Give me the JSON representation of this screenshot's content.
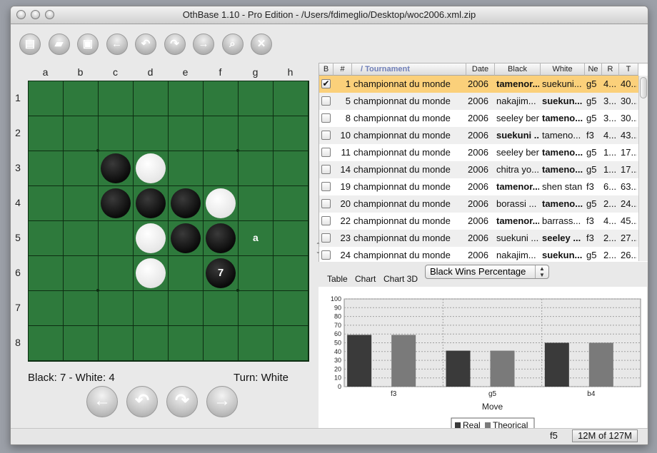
{
  "window": {
    "title": "OthBase 1.10 - Pro Edition - /Users/fdimeglio/Desktop/woc2006.xml.zip"
  },
  "toolbar": {
    "buttons": [
      {
        "name": "document-icon",
        "glyph": "▤"
      },
      {
        "name": "open-icon",
        "glyph": "▰"
      },
      {
        "name": "save-icon",
        "glyph": "▣"
      },
      {
        "name": "first-icon",
        "glyph": "←"
      },
      {
        "name": "back-icon",
        "glyph": "↶"
      },
      {
        "name": "forward-icon",
        "glyph": "↷"
      },
      {
        "name": "last-icon",
        "glyph": "→"
      },
      {
        "name": "search-icon",
        "glyph": "⌕"
      },
      {
        "name": "tools-icon",
        "glyph": "✕"
      }
    ]
  },
  "board": {
    "columns": [
      "a",
      "b",
      "c",
      "d",
      "e",
      "f",
      "g",
      "h"
    ],
    "rows": [
      "1",
      "2",
      "3",
      "4",
      "5",
      "6",
      "7",
      "8"
    ],
    "discs": [
      {
        "cell": "c3",
        "color": "black"
      },
      {
        "cell": "d3",
        "color": "white"
      },
      {
        "cell": "c4",
        "color": "black"
      },
      {
        "cell": "d4",
        "color": "black"
      },
      {
        "cell": "e4",
        "color": "black"
      },
      {
        "cell": "f4",
        "color": "white"
      },
      {
        "cell": "d5",
        "color": "white"
      },
      {
        "cell": "e5",
        "color": "black"
      },
      {
        "cell": "f5",
        "color": "black"
      },
      {
        "cell": "d6",
        "color": "white"
      },
      {
        "cell": "f6",
        "color": "black",
        "number": "7"
      }
    ],
    "hint": {
      "cell": "g5",
      "label": "a"
    },
    "colors": {
      "board": "#2e7a3c",
      "line": "#0d2d12"
    }
  },
  "status": {
    "score": "Black: 7 - White: 4",
    "turn": "Turn: White"
  },
  "nav_buttons": [
    {
      "name": "first-move-button",
      "glyph": "←"
    },
    {
      "name": "previous-move-button",
      "glyph": "↶"
    },
    {
      "name": "next-move-button",
      "glyph": "↷"
    },
    {
      "name": "last-move-button",
      "glyph": "→"
    }
  ],
  "table": {
    "columns": [
      "B",
      "#",
      "/ Tournament",
      "Date",
      "Black",
      "White",
      "Ne",
      "R",
      "T"
    ],
    "rows": [
      {
        "checked": true,
        "num": "1",
        "tournament": "championnat du monde",
        "date": "2006",
        "black": "tamenor...",
        "white": "suekuni...",
        "next": "g5",
        "r": "4...",
        "t": "40...",
        "black_bold": true,
        "white_bold": false,
        "selected": true
      },
      {
        "checked": false,
        "num": "5",
        "tournament": "championnat du monde",
        "date": "2006",
        "black": "nakajim...",
        "white": "suekun...",
        "next": "g5",
        "r": "3...",
        "t": "30...",
        "black_bold": false,
        "white_bold": true
      },
      {
        "checked": false,
        "num": "8",
        "tournament": "championnat du monde",
        "date": "2006",
        "black": "seeley ben",
        "white": "tameno...",
        "next": "g5",
        "r": "3...",
        "t": "30...",
        "black_bold": false,
        "white_bold": true
      },
      {
        "checked": false,
        "num": "10",
        "tournament": "championnat du monde",
        "date": "2006",
        "black": "suekuni ...",
        "white": "tameno...",
        "next": "f3",
        "r": "4...",
        "t": "43...",
        "black_bold": true,
        "white_bold": false
      },
      {
        "checked": false,
        "num": "11",
        "tournament": "championnat du monde",
        "date": "2006",
        "black": "seeley ben",
        "white": "tameno...",
        "next": "g5",
        "r": "1...",
        "t": "17...",
        "black_bold": false,
        "white_bold": true
      },
      {
        "checked": false,
        "num": "14",
        "tournament": "championnat du monde",
        "date": "2006",
        "black": "chitra yo...",
        "white": "tameno...",
        "next": "g5",
        "r": "1...",
        "t": "17...",
        "black_bold": false,
        "white_bold": true
      },
      {
        "checked": false,
        "num": "19",
        "tournament": "championnat du monde",
        "date": "2006",
        "black": "tamenor...",
        "white": "shen stan",
        "next": "f3",
        "r": "6...",
        "t": "63...",
        "black_bold": true,
        "white_bold": false
      },
      {
        "checked": false,
        "num": "20",
        "tournament": "championnat du monde",
        "date": "2006",
        "black": "borassi ...",
        "white": "tameno...",
        "next": "g5",
        "r": "2...",
        "t": "24...",
        "black_bold": false,
        "white_bold": true
      },
      {
        "checked": false,
        "num": "22",
        "tournament": "championnat du monde",
        "date": "2006",
        "black": "tamenor...",
        "white": "barrass...",
        "next": "f3",
        "r": "4...",
        "t": "45...",
        "black_bold": true,
        "white_bold": false
      },
      {
        "checked": false,
        "num": "23",
        "tournament": "championnat du monde",
        "date": "2006",
        "black": "suekuni ...",
        "white": "seeley ...",
        "next": "f3",
        "r": "2...",
        "t": "27...",
        "black_bold": false,
        "white_bold": true
      },
      {
        "checked": false,
        "num": "24",
        "tournament": "championnat du monde",
        "date": "2006",
        "black": "nakajim...",
        "white": "suekun...",
        "next": "g5",
        "r": "2...",
        "t": "26...",
        "black_bold": false,
        "white_bold": true
      }
    ]
  },
  "view_tabs": [
    "Table",
    "Chart",
    "Chart 3D"
  ],
  "chart_select": {
    "value": "Black Wins Percentage"
  },
  "chart_data": {
    "type": "bar",
    "categories": [
      "f3",
      "g5",
      "b4"
    ],
    "series": [
      {
        "name": "Real",
        "values": [
          59,
          41,
          50
        ],
        "color": "#3a3a3a"
      },
      {
        "name": "Theorical",
        "values": [
          59,
          41,
          50
        ],
        "color": "#7a7a7a"
      }
    ],
    "xlabel": "Move",
    "ylabel": "",
    "ylim": [
      0,
      100
    ],
    "yticks": [
      0,
      10,
      20,
      30,
      40,
      50,
      60,
      70,
      80,
      90,
      100
    ],
    "grid": true,
    "legend": "bottom"
  },
  "bottom": {
    "current_move": "f5",
    "memory": "12M of 127M"
  }
}
